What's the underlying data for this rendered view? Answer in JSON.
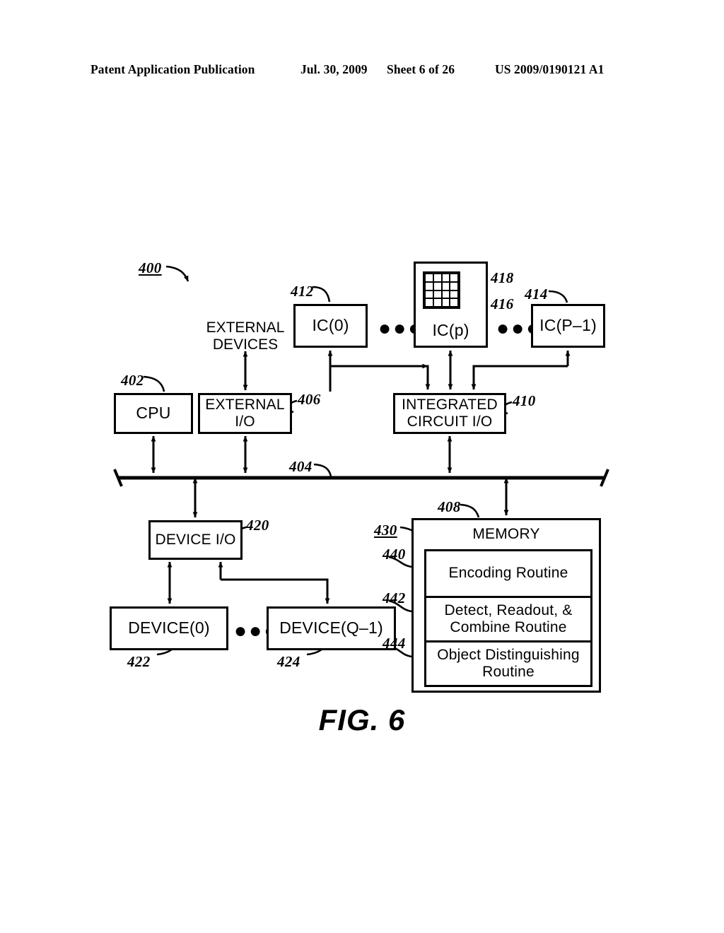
{
  "header": {
    "publication": "Patent Application Publication",
    "date": "Jul. 30, 2009",
    "sheet": "Sheet 6 of 26",
    "patent_number": "US 2009/0190121 A1"
  },
  "figure": {
    "caption": "FIG. 6",
    "system_numeral": "400"
  },
  "blocks": {
    "ic0": "IC(0)",
    "icp": "IC(p)",
    "icp1": "IC(P–1)",
    "cpu": "CPU",
    "external_io": "EXTERNAL\nI/O",
    "external_io_line1": "EXTERNAL",
    "external_io_line2": "I/O",
    "integrated_circuit_io_line1": "INTEGRATED",
    "integrated_circuit_io_line2": "CIRCUIT I/O",
    "device_io": "DEVICE I/O",
    "device0": "DEVICE(0)",
    "deviceq1": "DEVICE(Q–1)",
    "memory_title": "MEMORY",
    "external_devices_line1": "EXTERNAL",
    "external_devices_line2": "DEVICES"
  },
  "memory_routines": [
    {
      "label": "Encoding Routine",
      "numeral": "440"
    },
    {
      "label": "Detect, Readout, & Combine Routine",
      "numeral": "442"
    },
    {
      "label": "Object Distinguishing Routine",
      "numeral": "444"
    }
  ],
  "memory_routine_lines": {
    "r0_l1": "Encoding Routine",
    "r1_l1": "Detect, Readout, &",
    "r1_l2": "Combine Routine",
    "r2_l1": "Object Distinguishing",
    "r2_l2": "Routine"
  },
  "numerals": {
    "n400": "400",
    "n402": "402",
    "n404": "404",
    "n406": "406",
    "n408": "408",
    "n410": "410",
    "n412": "412",
    "n414": "414",
    "n416": "416",
    "n418": "418",
    "n420": "420",
    "n422": "422",
    "n424": "424",
    "n430": "430",
    "n440": "440",
    "n442": "442",
    "n444": "444"
  },
  "ellipsis": {
    "glyph": "●●●"
  },
  "colors": {
    "ink": "#000000",
    "paper": "#ffffff"
  }
}
